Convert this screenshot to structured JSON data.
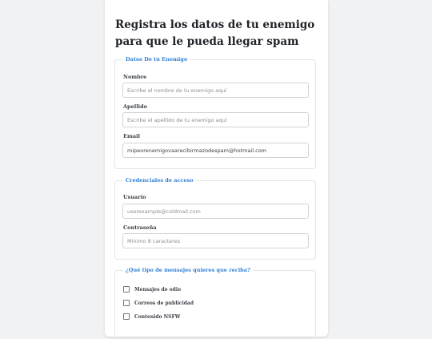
{
  "form": {
    "title": "Registra los datos de tu enemigo para que le pueda llegar spam"
  },
  "enemy_section": {
    "legend": "Datos De tu Enemigo",
    "name_label": "Nombre",
    "name_placeholder": "Escribe el nombre de tu enemigo aquí",
    "surname_label": "Apellido",
    "surname_placeholder": "Escribe el apellido de tu enemigo aquí",
    "email_label": "Email",
    "email_value": "mipeorenemigovaarecibirmazodespam@hotmail.com"
  },
  "credentials_section": {
    "legend": "Credenciales de acceso",
    "user_label": "Usuario",
    "user_placeholder": "userexample@coldmail.com",
    "password_label": "Contraseña",
    "password_placeholder": "Mínimo 8 caracteres"
  },
  "message_section": {
    "legend": "¿Qué tipo de mensajes quieres que reciba?",
    "options": [
      {
        "label": "Mensajes de odio",
        "checked": false
      },
      {
        "label": "Correos de publicidad",
        "checked": false
      },
      {
        "label": "Contenido NSFW",
        "checked": false
      }
    ]
  }
}
